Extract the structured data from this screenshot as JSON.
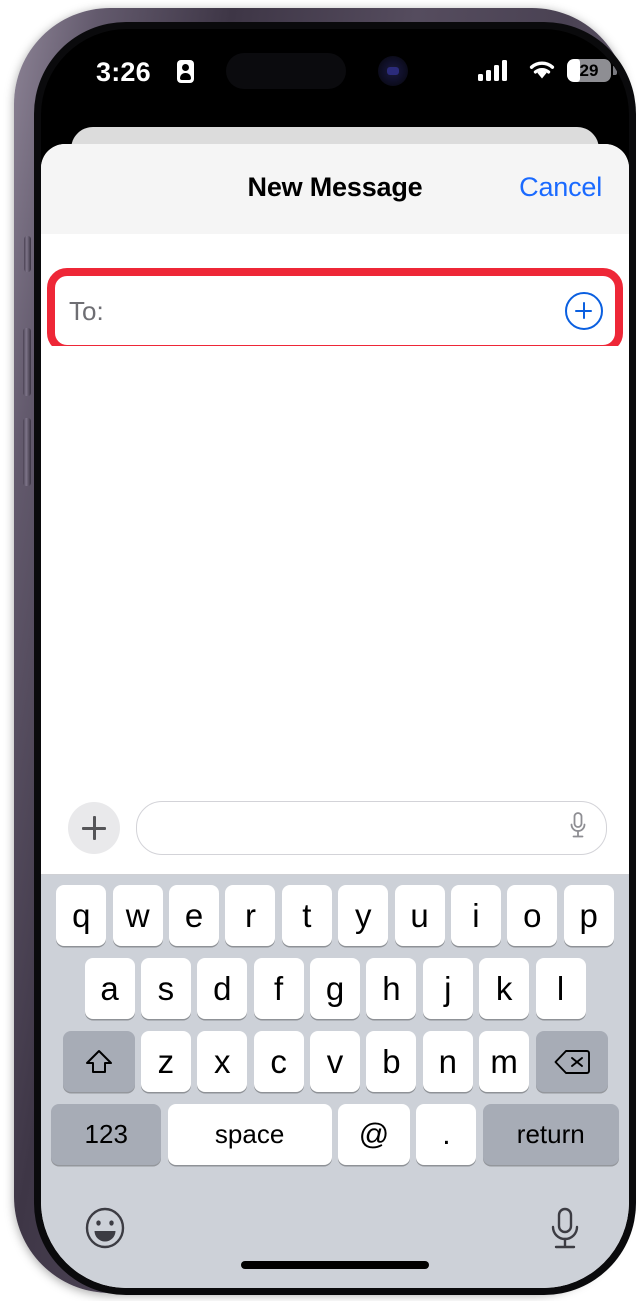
{
  "status_bar": {
    "time": "3:26",
    "privacy_icon": "contact-card-icon",
    "signal_icon": "cellular-signal-icon",
    "wifi_icon": "wifi-icon",
    "battery_percent": "29",
    "battery_level_pct": 29
  },
  "sheet": {
    "title": "New Message",
    "cancel_label": "Cancel",
    "recipient": {
      "label": "To:",
      "value": "",
      "placeholder": "",
      "add_contact_icon": "add-contact-plus-circle-icon"
    }
  },
  "compose": {
    "attach_icon": "plus-icon",
    "message_value": "",
    "message_placeholder": "",
    "mic_icon": "microphone-icon"
  },
  "keyboard": {
    "row1": [
      "q",
      "w",
      "e",
      "r",
      "t",
      "y",
      "u",
      "i",
      "o",
      "p"
    ],
    "row2": [
      "a",
      "s",
      "d",
      "f",
      "g",
      "h",
      "j",
      "k",
      "l"
    ],
    "row3": [
      "z",
      "x",
      "c",
      "v",
      "b",
      "n",
      "m"
    ],
    "shift_icon": "shift-arrow-icon",
    "delete_icon": "backspace-delete-icon",
    "numbers_label": "123",
    "space_label": "space",
    "at_label": "@",
    "period_label": ".",
    "return_label": "return",
    "emoji_icon": "emoji-smiley-icon",
    "dictation_icon": "microphone-icon"
  },
  "annotation": {
    "highlight_color": "#ee2737",
    "target": "recipient-to-field"
  },
  "colors": {
    "accent_blue": "#1a6aff",
    "add_button_blue": "#0a5fe0",
    "keyboard_bg": "#cdd1d8",
    "key_dark": "#a7acb6",
    "header_bg": "#f5f5f5",
    "placeholder_gray": "#6e6e73"
  }
}
